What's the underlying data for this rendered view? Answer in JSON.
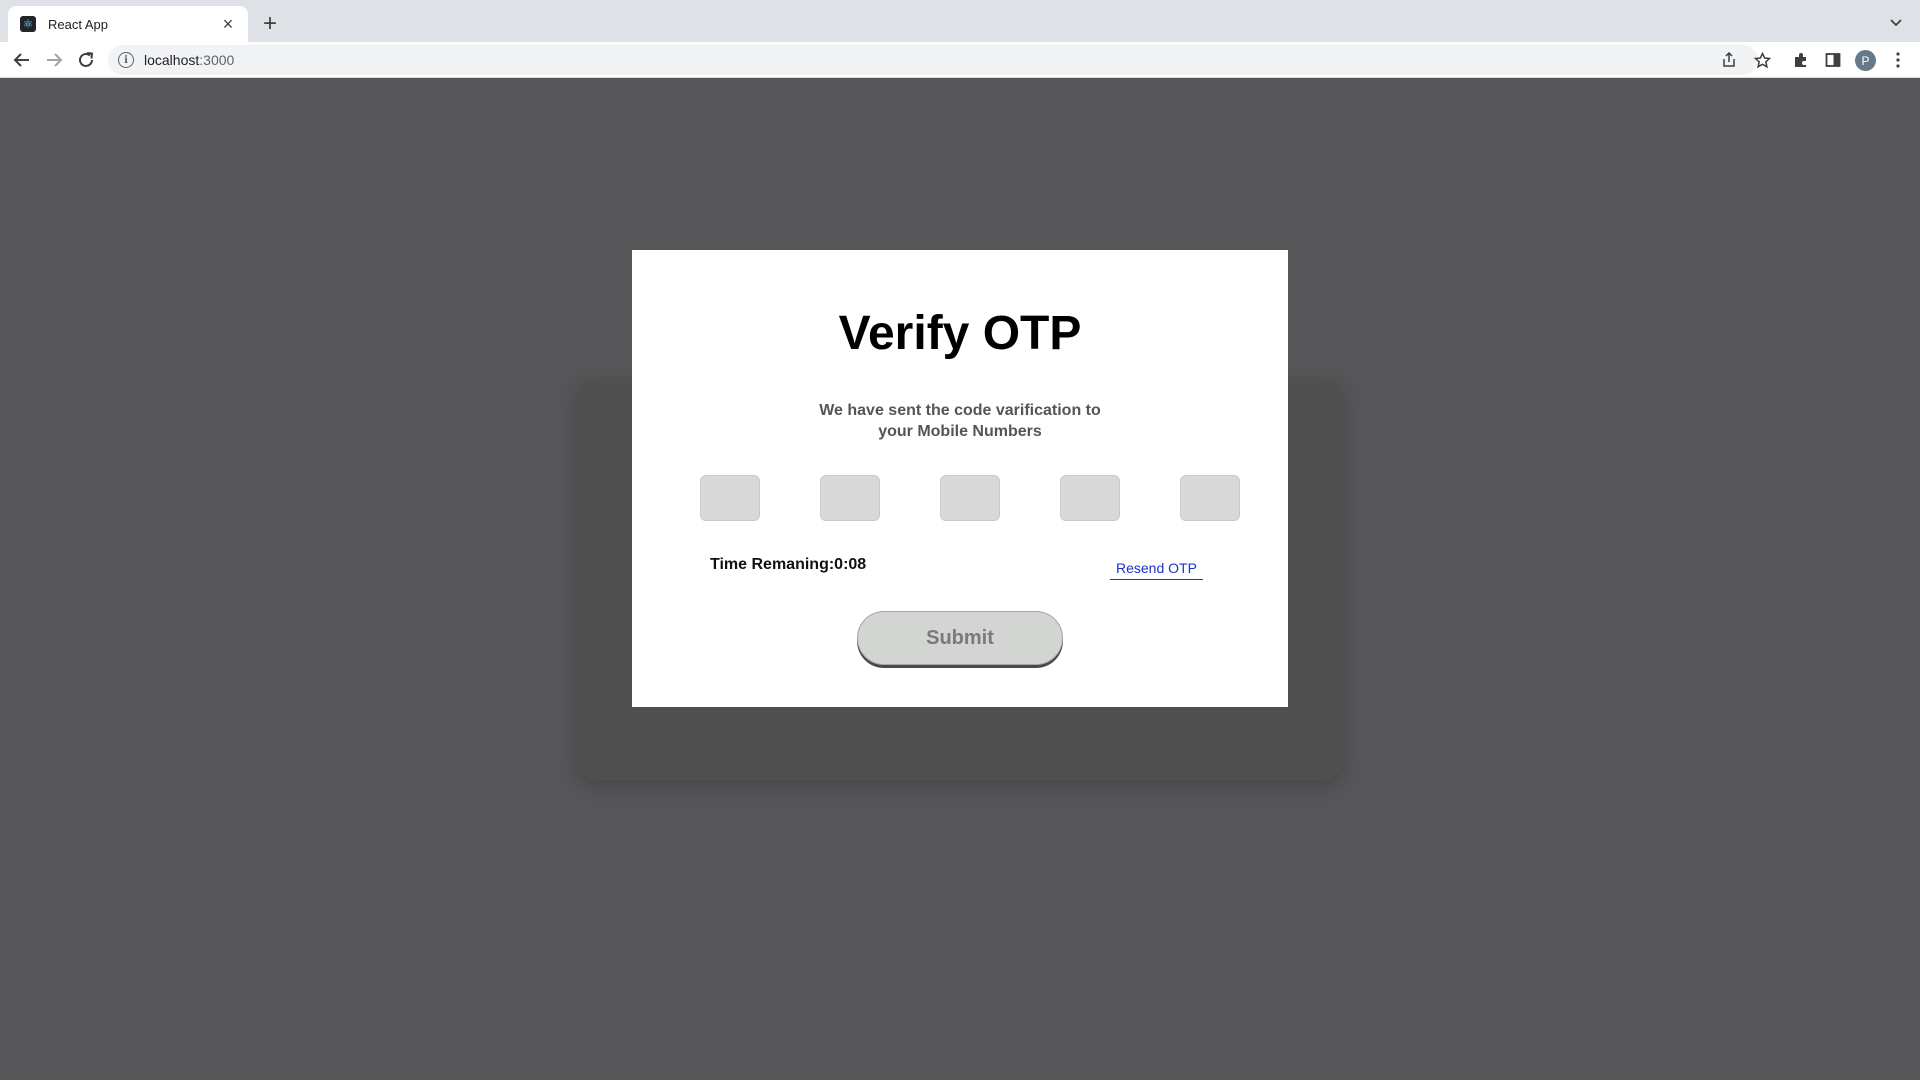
{
  "browser": {
    "tab": {
      "title": "React App",
      "favicon": "react-logo-icon"
    },
    "url": {
      "host": "localhost",
      "port": ":3000"
    },
    "avatar_letter": "P",
    "icons": [
      "back-arrow-icon",
      "forward-arrow-icon",
      "reload-icon",
      "info-icon",
      "share-icon",
      "star-icon",
      "extensions-icon",
      "side-panel-icon",
      "more-menu-icon"
    ]
  },
  "modal": {
    "title": "Verify OTP",
    "subtitle_line1": "We have sent the code varification to",
    "subtitle_line2": "your Mobile Numbers",
    "otp_digits": [
      "",
      "",
      "",
      "",
      ""
    ],
    "timer_label": "Time Remaning:",
    "timer_value": "0:08",
    "resend_label": "Resend OTP",
    "submit_label": "Submit"
  },
  "colors": {
    "page_background": "#565658",
    "modal_background": "#ffffff",
    "otp_box": "#d9d9d9",
    "link": "#1a33c9",
    "submit_background": "#d3d5d3"
  }
}
